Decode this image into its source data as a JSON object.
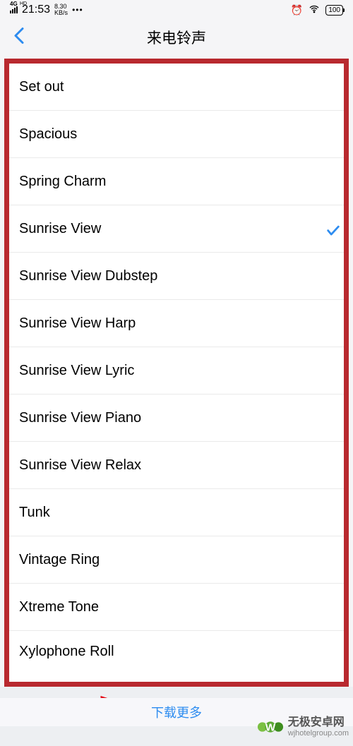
{
  "status": {
    "network_type": "4G",
    "hd": "HD",
    "time": "21:53",
    "speed_value": "8.30",
    "speed_unit": "KB/s",
    "dots": "•••",
    "battery": "100"
  },
  "header": {
    "title": "来电铃声"
  },
  "ringtones": [
    {
      "name": "Set out",
      "selected": false
    },
    {
      "name": "Spacious",
      "selected": false
    },
    {
      "name": "Spring Charm",
      "selected": false
    },
    {
      "name": "Sunrise View",
      "selected": true
    },
    {
      "name": "Sunrise View Dubstep",
      "selected": false
    },
    {
      "name": "Sunrise View Harp",
      "selected": false
    },
    {
      "name": "Sunrise View Lyric",
      "selected": false
    },
    {
      "name": "Sunrise View Piano",
      "selected": false
    },
    {
      "name": "Sunrise View Relax",
      "selected": false
    },
    {
      "name": "Tunk",
      "selected": false
    },
    {
      "name": "Vintage Ring",
      "selected": false
    },
    {
      "name": "Xtreme Tone",
      "selected": false
    },
    {
      "name": "Xylophone Roll",
      "selected": false
    }
  ],
  "footer": {
    "download_more": "下载更多"
  },
  "watermark": {
    "title": "无极安卓网",
    "url": "wjhotelgroup.com"
  },
  "annotation": {
    "highlight_color": "#B8292F",
    "arrow_color": "#E30613"
  }
}
